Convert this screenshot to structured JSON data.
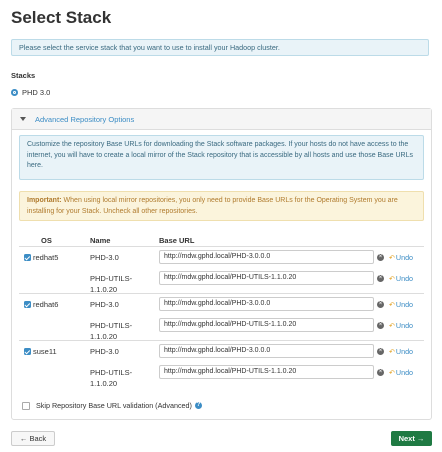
{
  "page": {
    "title": "Select Stack",
    "intro": "Please select the service stack that you want to use to install your Hadoop cluster."
  },
  "stacks": {
    "label": "Stacks",
    "selected": "PHD 3.0"
  },
  "repo_panel": {
    "title": "Advanced Repository Options",
    "info": "Customize the repository Base URLs for downloading the Stack software packages. If your hosts do not have access to the internet, you will have to create a local mirror of the Stack repository that is accessible by all hosts and use those Base URLs here.",
    "warning_label": "Important:",
    "warning_text": " When using local mirror repositories, you only need to provide Base URLs for the Operating System you are installing for your Stack. Uncheck all other repositories.",
    "columns": {
      "os": "OS",
      "name": "Name",
      "base_url": "Base URL"
    },
    "undo_label": "Undo",
    "os_groups": [
      {
        "os": "redhat5",
        "checked": true,
        "repos": [
          {
            "name": "PHD-3.0",
            "url": "http://mdw.gphd.local/PHD-3.0.0.0"
          },
          {
            "name": "PHD-UTILS-1.1.0.20",
            "url": "http://mdw.gphd.local/PHD-UTILS-1.1.0.20"
          }
        ]
      },
      {
        "os": "redhat6",
        "checked": true,
        "repos": [
          {
            "name": "PHD-3.0",
            "url": "http://mdw.gphd.local/PHD-3.0.0.0"
          },
          {
            "name": "PHD-UTILS-1.1.0.20",
            "url": "http://mdw.gphd.local/PHD-UTILS-1.1.0.20"
          }
        ]
      },
      {
        "os": "suse11",
        "checked": true,
        "repos": [
          {
            "name": "PHD-3.0",
            "url": "http://mdw.gphd.local/PHD-3.0.0.0"
          },
          {
            "name": "PHD-UTILS-1.1.0.20",
            "url": "http://mdw.gphd.local/PHD-UTILS-1.1.0.20"
          }
        ]
      }
    ],
    "skip_validation": "Skip Repository Base URL validation (Advanced)"
  },
  "footer": {
    "back_label": "← Back",
    "next_label": "Next →"
  }
}
